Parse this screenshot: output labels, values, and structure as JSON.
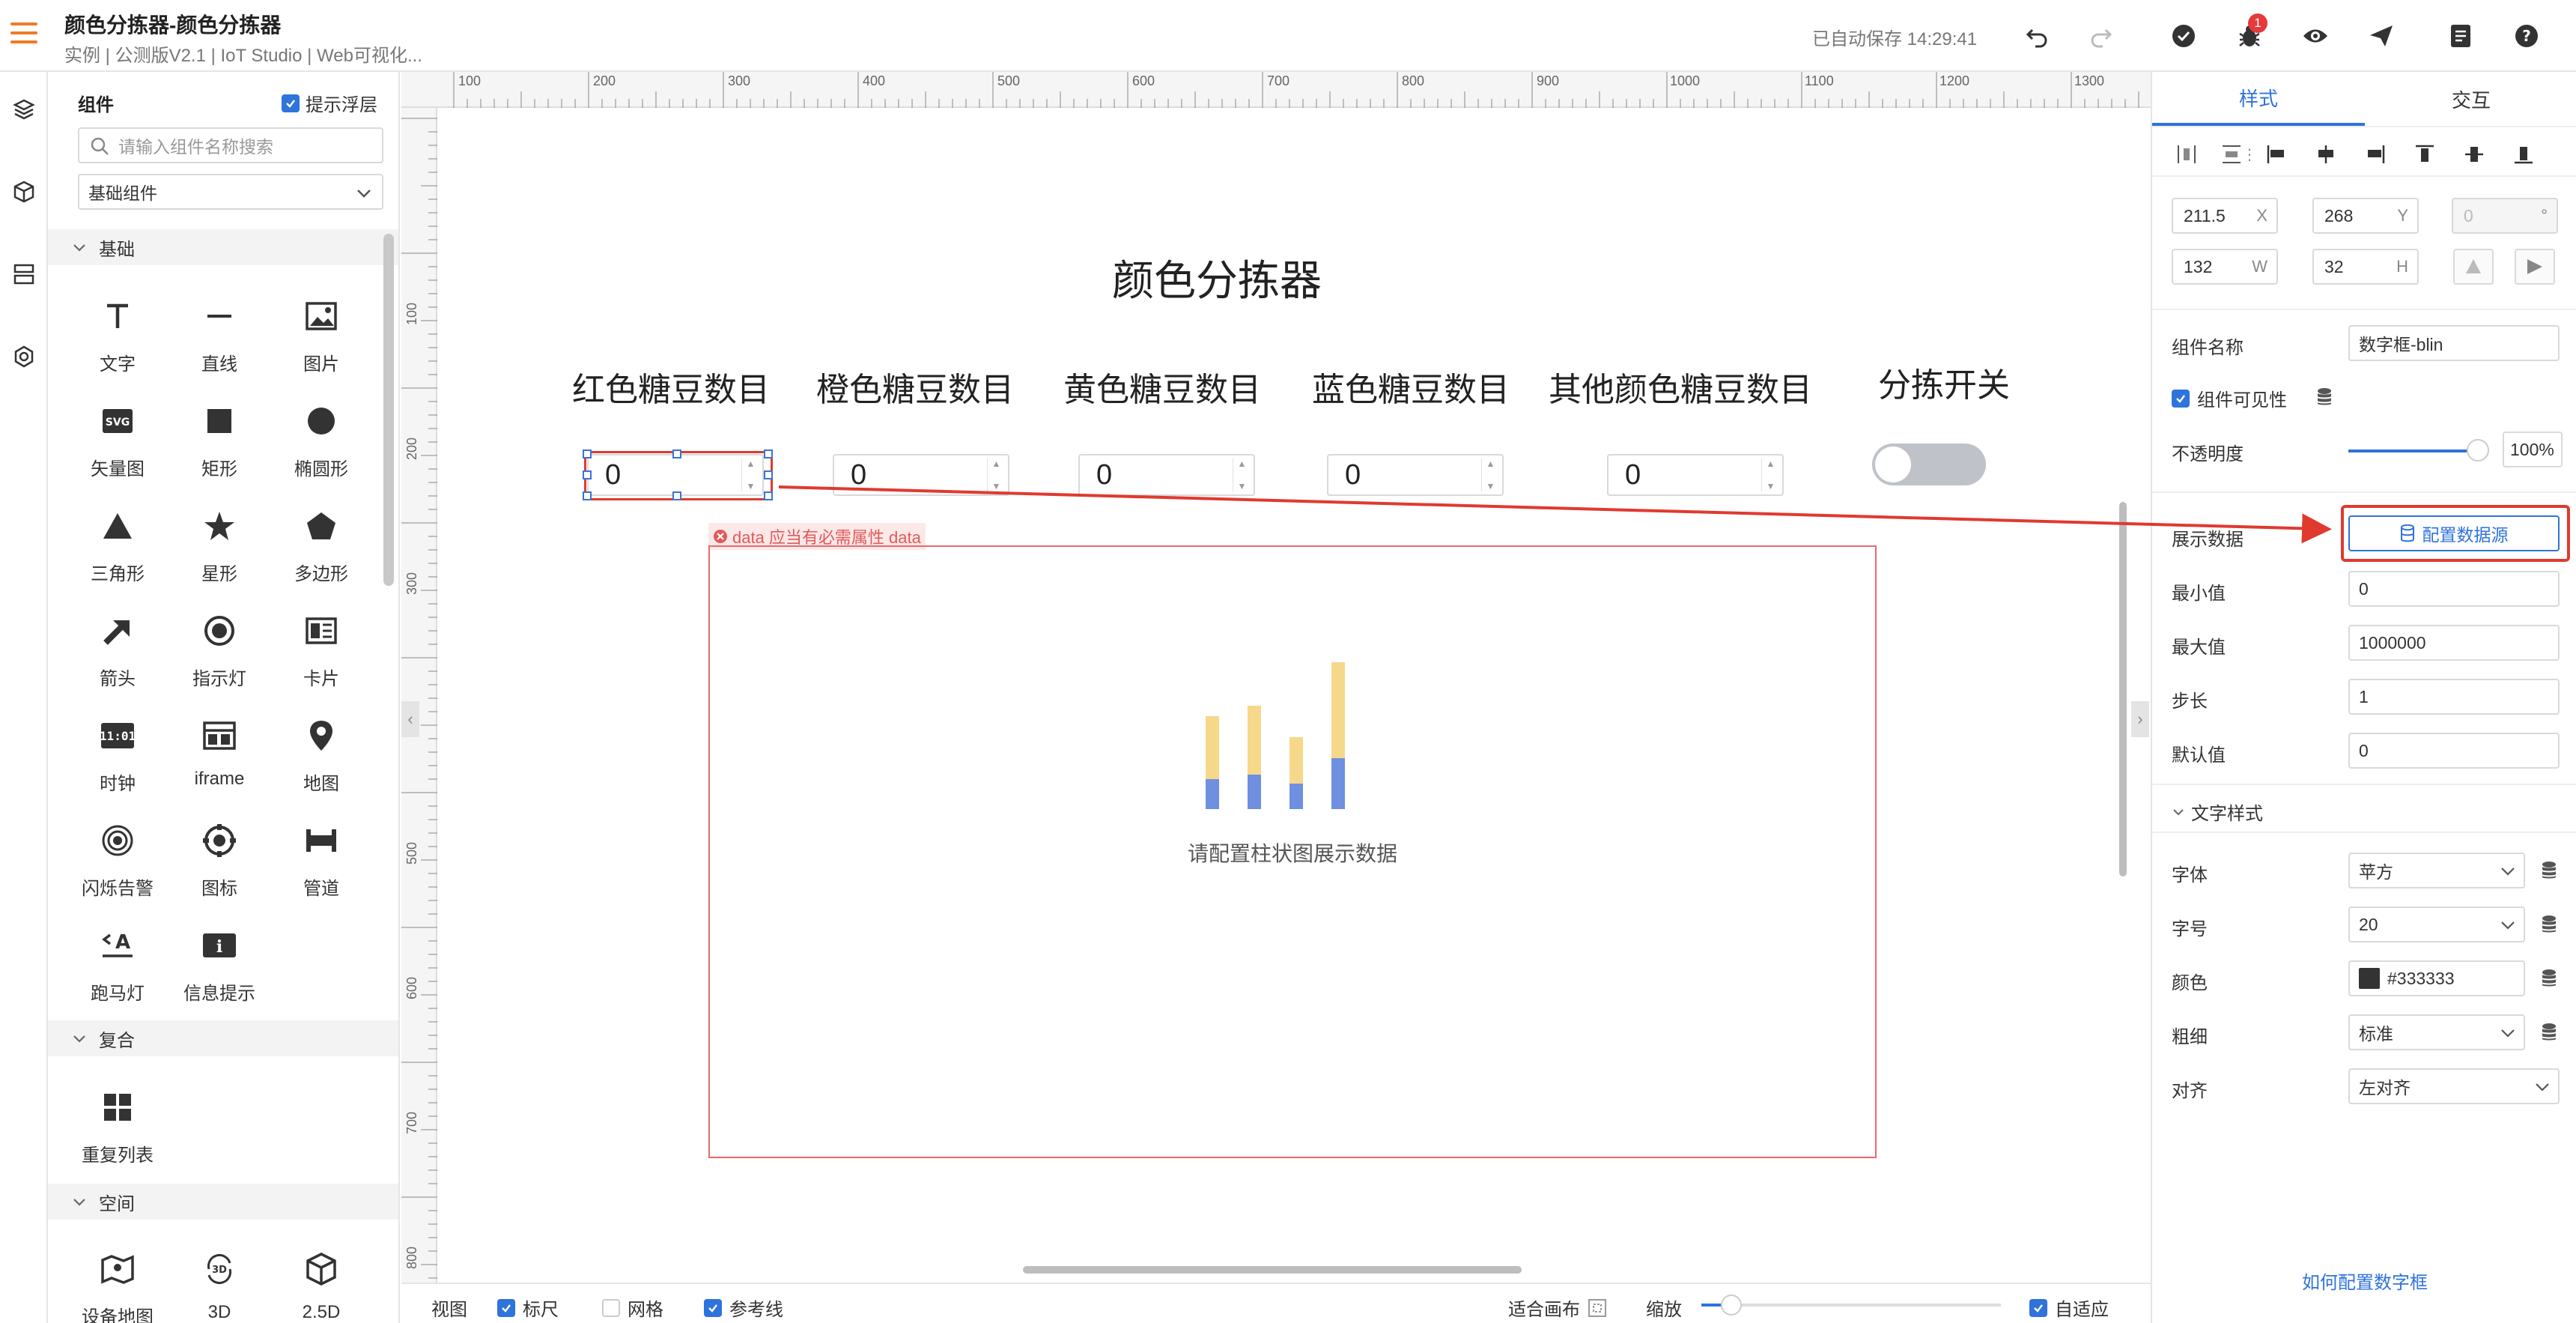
{
  "header": {
    "title": "颜色分拣器-颜色分拣器",
    "subtitle": "实例 | 公测版V2.1 | IoT Studio | Web可视化...",
    "autosave": "已自动保存 14:29:41",
    "bug_badge": "1"
  },
  "component_panel": {
    "title": "组件",
    "hint_label": "提示浮层",
    "search_placeholder": "请输入组件名称搜索",
    "category_select": "基础组件",
    "categories": {
      "basic": "基础",
      "composite": "复合",
      "space": "空间"
    },
    "basic_items": [
      "文字",
      "直线",
      "图片",
      "矢量图",
      "矩形",
      "椭圆形",
      "三角形",
      "星形",
      "多边形",
      "箭头",
      "指示灯",
      "卡片",
      "时钟",
      "iframe",
      "地图",
      "闪烁告警",
      "图标",
      "管道",
      "跑马灯",
      "信息提示"
    ],
    "composite_items": [
      "重复列表"
    ],
    "space_items": [
      "设备地图",
      "3D",
      "2.5D"
    ],
    "svg_icon_text": "SVG",
    "clock_icon_text": "11:01"
  },
  "ruler": {
    "top": [
      "100",
      "200",
      "300",
      "400",
      "500",
      "600",
      "700",
      "800",
      "900",
      "1000",
      "1100",
      "1200",
      "1300"
    ],
    "left": [
      "100",
      "200",
      "300",
      "400",
      "500",
      "600",
      "700",
      "800"
    ]
  },
  "canvas": {
    "title": "颜色分拣器",
    "columns": [
      "红色糖豆数目",
      "橙色糖豆数目",
      "黄色糖豆数目",
      "蓝色糖豆数目",
      "其他颜色糖豆数目",
      "分拣开关"
    ],
    "number_values": [
      "0",
      "0",
      "0",
      "0",
      "0"
    ],
    "error_tag": "data 应当有必需属性 data",
    "chart_hint": "请配置柱状图展示数据"
  },
  "bottom_bar": {
    "view": "视图",
    "ruler": "标尺",
    "grid": "网格",
    "guides": "参考线",
    "fit_canvas": "适合画布",
    "zoom": "缩放",
    "auto_fit": "自适应",
    "zoom_level": 0.1
  },
  "props": {
    "tabs": [
      "样式",
      "交互"
    ],
    "x": "211.5",
    "y": "268",
    "rotation": "0",
    "w": "132",
    "h": "32",
    "x_label": "X",
    "y_label": "Y",
    "w_label": "W",
    "h_label": "H",
    "rot_label": "°",
    "component_name_label": "组件名称",
    "component_name": "数字框-blin",
    "visible_label": "组件可见性",
    "opacity_label": "不透明度",
    "opacity_value": "100%",
    "data_label": "展示数据",
    "data_source_btn": "配置数据源",
    "min_label": "最小值",
    "min_value": "0",
    "max_label": "最大值",
    "max_value": "1000000",
    "step_label": "步长",
    "step_value": "1",
    "default_label": "默认值",
    "default_value": "0",
    "text_style_section": "文字样式",
    "font_label": "字体",
    "font_value": "苹方",
    "size_label": "字号",
    "size_value": "20",
    "color_label": "颜色",
    "color_value": "#333333",
    "weight_label": "粗细",
    "weight_value": "标准",
    "align_label": "对齐",
    "align_value": "左对齐",
    "help_link": "如何配置数字框"
  },
  "colors": {
    "accent": "#2f73dc",
    "brand_orange": "#f07a28",
    "highlight_red": "#e03a2f",
    "bar_yellow": "#f6d88a",
    "bar_blue": "#6f8fe0"
  }
}
